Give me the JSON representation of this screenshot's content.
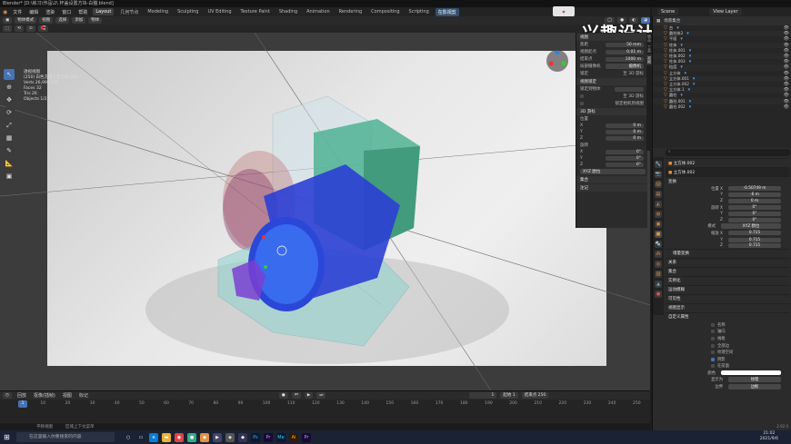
{
  "app": {
    "title": "Blender* [D:\\练习\\作品\\2\\ 杯盖设置方块-白猫.blend]",
    "menus": [
      "文件",
      "编辑",
      "渲染",
      "窗口",
      "帮助"
    ],
    "workspaces": [
      "Layout",
      "几何节点",
      "Modeling",
      "Sculpting",
      "UV Editing",
      "Texture Paint",
      "Shading",
      "Animation",
      "Rendering",
      "Compositing",
      "Scripting"
    ],
    "active_workspace": "Layout",
    "extra_tab": "在影视剪",
    "scene_label": "Scene",
    "view_layer_label": "View Layer"
  },
  "viewport": {
    "mode": "物体模式",
    "header_buttons": [
      "视图",
      "选择",
      "添加",
      "物体"
    ],
    "overlay_lines": [
      "透视视图",
      "(250) 白色方块 | 立方体.002",
      "Verts 26,990,720",
      "Faces 32",
      "Tris 26",
      "Objects 1/27"
    ],
    "camera_label": "摄像机"
  },
  "toolbar": {
    "tools": [
      "select-icon",
      "cursor-icon",
      "move-icon",
      "rotate-icon",
      "scale-icon",
      "transform-icon",
      "annotate-icon",
      "measure-icon",
      "add-cube-icon"
    ]
  },
  "npanel": {
    "view_section": "视图",
    "focal_label": "焦距",
    "focal_value": "50 mm",
    "clip_start_label": "视图起点",
    "clip_start_value": "0.01 m",
    "clip_end_label": "结束点",
    "clip_end_value": "1000 m",
    "local_camera_label": "局部摄像机",
    "local_camera_value": "摄像机",
    "lock_label": "锁定",
    "lock_value": "至 3D 游标",
    "view_lock_section": "视图锁定",
    "lock_obj_label": "锁定到物体",
    "lock_cursor_label": "至 3D 游标",
    "lock_cam_label": "锁定相机到视图",
    "cursor_section": "3D 游标",
    "location_label": "位置",
    "loc": [
      {
        "axis": "X",
        "value": "0 m"
      },
      {
        "axis": "Y",
        "value": "0 m"
      },
      {
        "axis": "Z",
        "value": "0 m"
      }
    ],
    "rotation_label": "旋转",
    "rot": [
      {
        "axis": "X",
        "value": "0°"
      },
      {
        "axis": "Y",
        "value": "0°"
      },
      {
        "axis": "Z",
        "value": "0°"
      }
    ],
    "rot_mode": "XYZ 欧拉",
    "collections_section": "集合",
    "annotations_section": "注记",
    "tabs": [
      "物品",
      "工具",
      "视图"
    ]
  },
  "outliner": {
    "header": "场景集合",
    "items": [
      "台",
      "圆柱体2",
      "平面",
      "柱体",
      "柱体.001",
      "柱体.002",
      "柱体.003",
      "粒度",
      "立方体",
      "立方体.001",
      "立方体.002",
      "立方体.1",
      "圆柱",
      "圆柱.001",
      "圆柱.002"
    ]
  },
  "properties": {
    "search_placeholder": "",
    "object_name": "立方体.002",
    "object_field": "立方体.002",
    "transform_section": "变换",
    "location_label": "位置 X",
    "location": [
      "-0.50749 m",
      "-6 m",
      "0 m"
    ],
    "rotation_label": "旋转 X",
    "rotation": [
      "0°",
      "0°",
      "0°"
    ],
    "mode_label": "模式",
    "mode_value": "XYZ 欧拉",
    "scale_label": "缩放 X",
    "scale": [
      "0.715",
      "0.715",
      "0.715"
    ],
    "delta_section": "增量变换",
    "sections": [
      "关系",
      "集合",
      "实例化",
      "运动模糊",
      "可见性",
      "视图显示",
      "自定义属性"
    ],
    "visibility_section": "可见性",
    "viewport_display_section": "视图显示",
    "display_label": "显示为",
    "display_value": "纹理",
    "checkboxes": [
      {
        "label": "名称",
        "on": false
      },
      {
        "label": "轴向",
        "on": false
      },
      {
        "label": "线框",
        "on": false
      },
      {
        "label": "全部边",
        "on": false
      },
      {
        "label": "纹理空间",
        "on": false
      },
      {
        "label": "阴影",
        "on": true
      },
      {
        "label": "在前面",
        "on": false
      }
    ],
    "color_label": "颜色",
    "bounds_label": "边界",
    "bounds_value": "边框",
    "version": "2.92.0"
  },
  "timeline": {
    "menus": [
      "回放",
      "抠像(插帧)",
      "视图",
      "标记"
    ],
    "current_frame": "1",
    "start_label": "起始",
    "start_value": "1",
    "end_label": "结束点",
    "end_value": "250",
    "ticks": [
      "10",
      "20",
      "30",
      "40",
      "50",
      "60",
      "70",
      "80",
      "90",
      "100",
      "110",
      "120",
      "130",
      "140",
      "150",
      "160",
      "170",
      "180",
      "190",
      "200",
      "210",
      "220",
      "230",
      "240",
      "250"
    ]
  },
  "statusbar": {
    "items": [
      "平移视图",
      "区域上下文菜单"
    ]
  },
  "taskbar": {
    "search_placeholder": "在这里输入你要搜索的内容",
    "time": "21:02",
    "date": "2021/9/6"
  },
  "watermark": {
    "text": "兴趣设计师k bilibili"
  },
  "colors": {
    "accent": "#4772b3",
    "orange": "#e09245",
    "panel": "#2b2b2b"
  }
}
